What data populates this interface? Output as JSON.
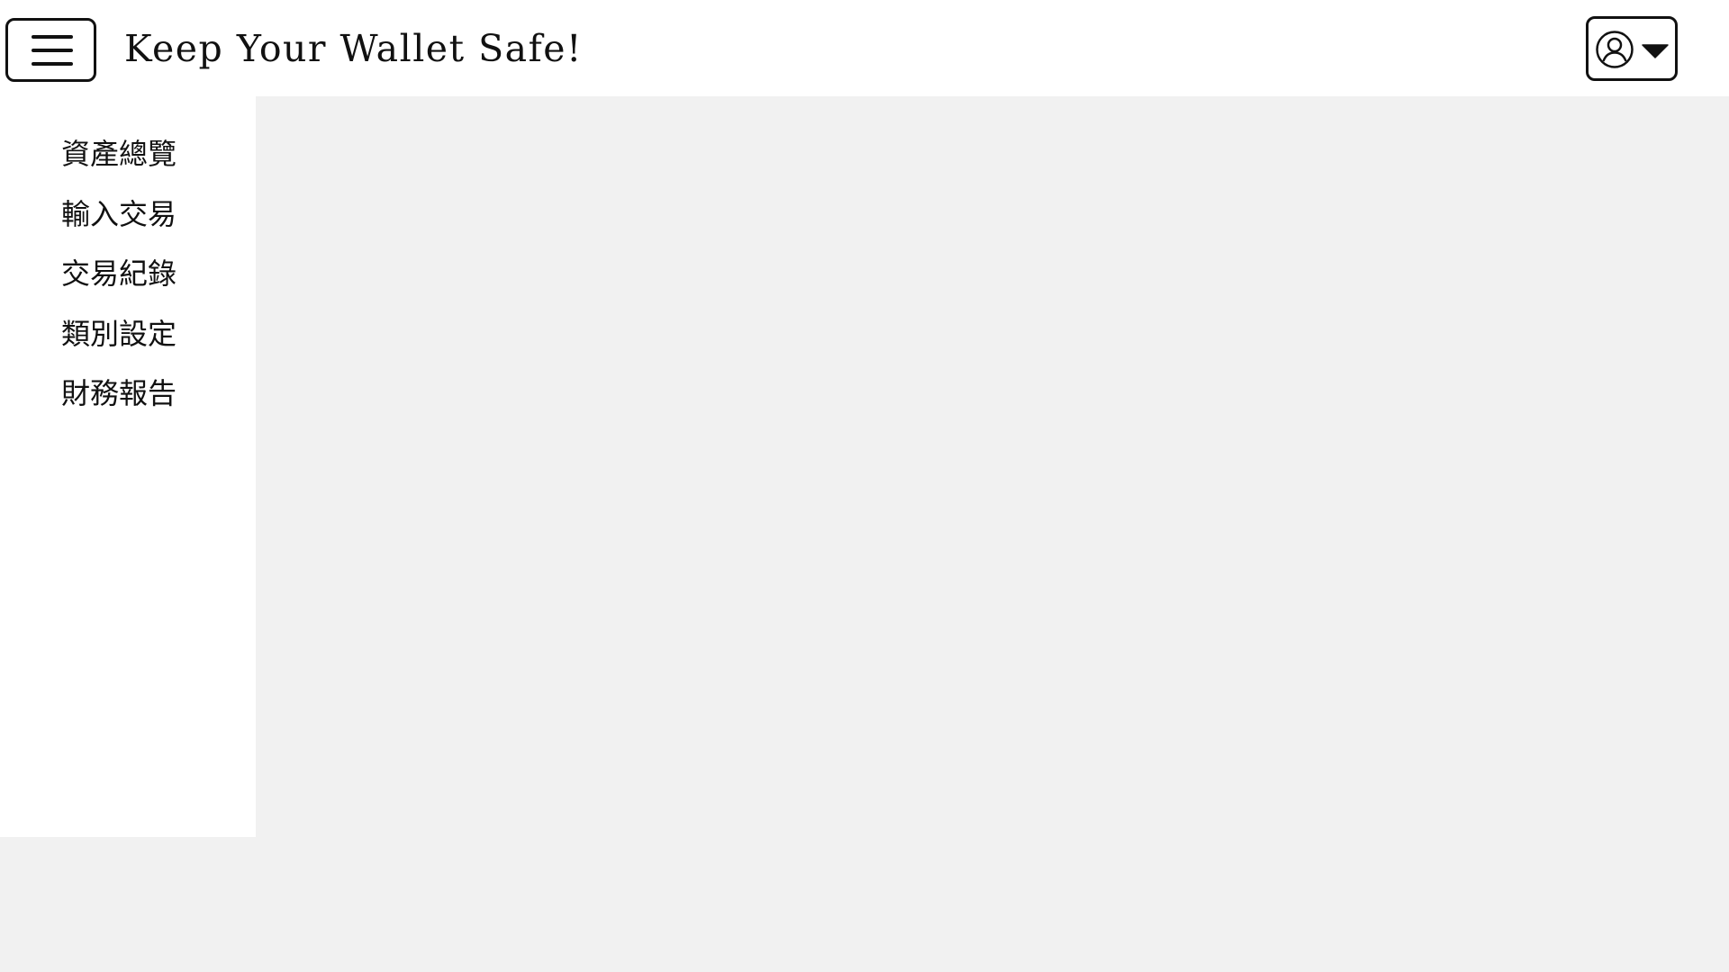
{
  "header": {
    "title": "Keep Your Wallet Safe!",
    "menu_icon": "hamburger-menu-icon",
    "user_icon": "user-circle-icon",
    "dropdown_icon": "caret-down-icon"
  },
  "sidebar": {
    "items": [
      {
        "label": "資產總覽"
      },
      {
        "label": "輸入交易"
      },
      {
        "label": "交易紀錄"
      },
      {
        "label": "類別設定"
      },
      {
        "label": "財務報告"
      }
    ]
  },
  "colors": {
    "background": "#f1f1f1",
    "surface": "#ffffff",
    "foreground": "#111111"
  }
}
